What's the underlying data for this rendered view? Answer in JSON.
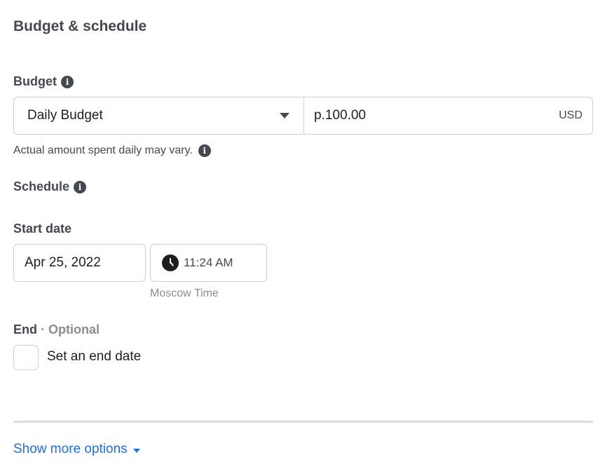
{
  "section": {
    "title": "Budget & schedule"
  },
  "budget": {
    "label": "Budget",
    "type_selected": "Daily Budget",
    "amount_value": "p.100.00",
    "currency": "USD",
    "hint": "Actual amount spent daily may vary."
  },
  "schedule": {
    "label": "Schedule",
    "start_date_label": "Start date",
    "start_date_value": "Apr 25, 2022",
    "start_time_value": "11:24 AM",
    "timezone": "Moscow Time",
    "end_label": "End",
    "end_optional": " · Optional",
    "end_checkbox_label": "Set an end date",
    "end_checkbox_checked": false
  },
  "footer": {
    "show_more_label": "Show more options"
  },
  "icons": {
    "info": "i"
  },
  "colors": {
    "link": "#216fdb",
    "label": "#444950",
    "border": "#ccd0d5"
  }
}
